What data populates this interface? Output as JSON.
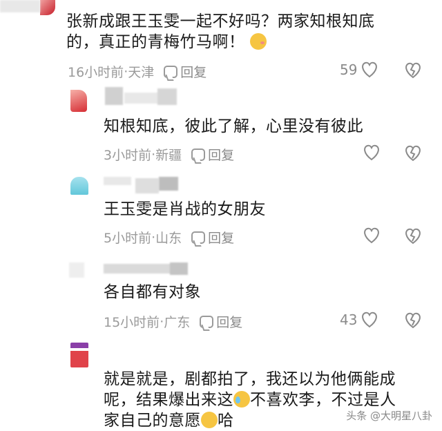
{
  "comments": [
    {
      "text_line1": "张新成跟王玉雯一起不好吗？两家知根知底",
      "text_line2": "的，真正的青梅竹马啊！",
      "time": "16小时前",
      "location": "天津",
      "reply_label": "回复",
      "likes": "59"
    },
    {
      "text": "知根知底，彼此了解，心里没有彼此",
      "time": "3小时前",
      "location": "新疆",
      "reply_label": "回复",
      "likes": ""
    },
    {
      "text": "王玉雯是肖战的女朋友",
      "time": "5小时前",
      "location": "山东",
      "reply_label": "回复",
      "likes": ""
    },
    {
      "text": "各自都有对象",
      "time": "15小时前",
      "location": "广东",
      "reply_label": "回复",
      "likes": "43"
    },
    {
      "text_line1": "就是就是，剧都拍了，我还以为他俩能成",
      "text_line2a": "呢，结果爆出来这",
      "text_line2b": "不喜欢李，不过是人",
      "text_line3a": "家自己的意愿",
      "text_line3b": "哈"
    }
  ],
  "separator": " · ",
  "watermark": "头条 @大明星八卦",
  "colors": {
    "avatar_red": "#e0434a",
    "avatar_cyan": "#7fd4e3",
    "avatar_purple": "#8a3fa8"
  }
}
